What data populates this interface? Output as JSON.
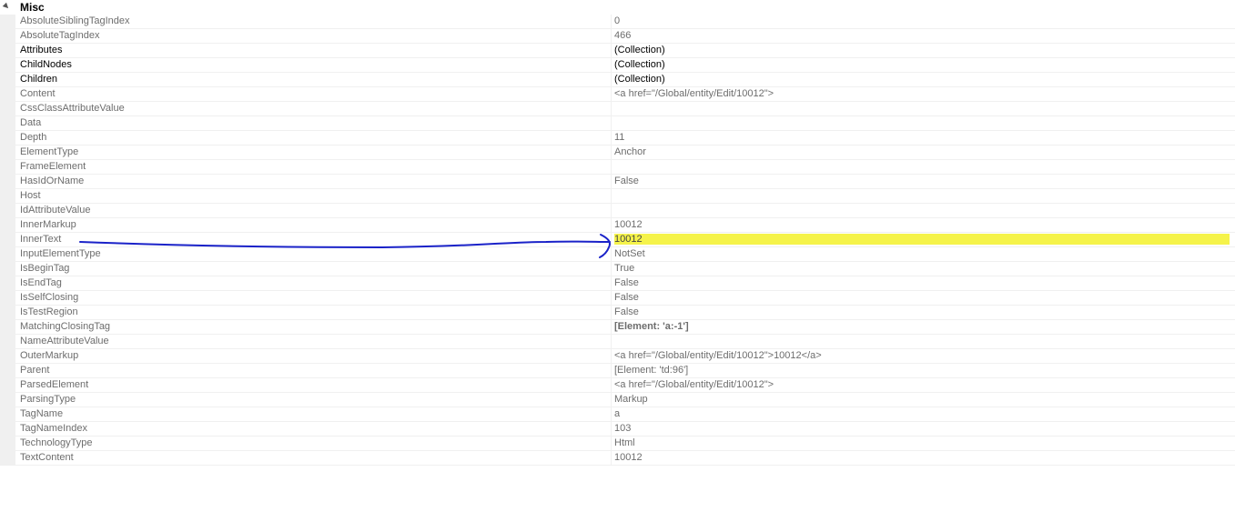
{
  "category": {
    "label": "Misc",
    "icon": "collapse-triangle-icon"
  },
  "properties": [
    {
      "name": "AbsoluteSiblingTagIndex",
      "value": "0"
    },
    {
      "name": "AbsoluteTagIndex",
      "value": "466"
    },
    {
      "name": "Attributes",
      "value": "(Collection)",
      "strong": true
    },
    {
      "name": "ChildNodes",
      "value": "(Collection)",
      "strong": true
    },
    {
      "name": "Children",
      "value": "(Collection)",
      "strong": true
    },
    {
      "name": "Content",
      "value": "<a href=\"/Global/entity/Edit/10012\">"
    },
    {
      "name": "CssClassAttributeValue",
      "value": ""
    },
    {
      "name": "Data",
      "value": ""
    },
    {
      "name": "Depth",
      "value": "11"
    },
    {
      "name": "ElementType",
      "value": "Anchor"
    },
    {
      "name": "FrameElement",
      "value": ""
    },
    {
      "name": "HasIdOrName",
      "value": "False"
    },
    {
      "name": "Host",
      "value": ""
    },
    {
      "name": "IdAttributeValue",
      "value": ""
    },
    {
      "name": "InnerMarkup",
      "value": "10012"
    },
    {
      "name": "InnerText",
      "value": "10012",
      "highlight": true
    },
    {
      "name": "InputElementType",
      "value": "NotSet"
    },
    {
      "name": "IsBeginTag",
      "value": "True"
    },
    {
      "name": "IsEndTag",
      "value": "False"
    },
    {
      "name": "IsSelfClosing",
      "value": "False"
    },
    {
      "name": "IsTestRegion",
      "value": "False"
    },
    {
      "name": "MatchingClosingTag",
      "value": "[Element: 'a:-1']",
      "bold": true
    },
    {
      "name": "NameAttributeValue",
      "value": ""
    },
    {
      "name": "OuterMarkup",
      "value": "<a href=\"/Global/entity/Edit/10012\">10012</a>"
    },
    {
      "name": "Parent",
      "value": "[Element: 'td:96']"
    },
    {
      "name": "ParsedElement",
      "value": "<a href=\"/Global/entity/Edit/10012\">"
    },
    {
      "name": "ParsingType",
      "value": "Markup"
    },
    {
      "name": "TagName",
      "value": "a"
    },
    {
      "name": "TagNameIndex",
      "value": "103"
    },
    {
      "name": "TechnologyType",
      "value": "Html"
    },
    {
      "name": "TextContent",
      "value": "10012"
    }
  ],
  "colors": {
    "highlight": "#f5f34a",
    "annotation_arrow": "#1a22c8",
    "gutter": "#f0f0f0"
  }
}
